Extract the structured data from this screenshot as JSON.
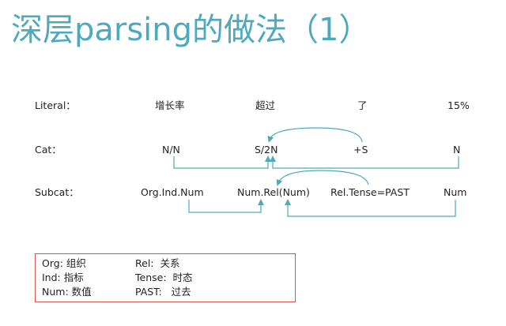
{
  "title": "深层parsing的做法（1）",
  "rows": {
    "literal": {
      "label": "Literal：",
      "tokens": [
        "增长率",
        "超过",
        "了",
        "15%"
      ]
    },
    "cat": {
      "label": "Cat：",
      "tokens": [
        "N/N",
        "S/2N",
        "+S",
        "N"
      ]
    },
    "subcat": {
      "label": "Subcat：",
      "tokens": [
        "Org.Ind.Num",
        "Num.Rel(Num)",
        "Rel.Tense=PAST",
        "Num"
      ]
    }
  },
  "legend": {
    "left": [
      {
        "key": "Org:",
        "value": "组织"
      },
      {
        "key": "Ind:",
        "value": "指标"
      },
      {
        "key": "Num:",
        "value": "数值"
      }
    ],
    "right": [
      {
        "key": "Rel:",
        "value": "关系"
      },
      {
        "key": "Tense:",
        "value": "时态"
      },
      {
        "key": "PAST:",
        "value": "过去"
      }
    ]
  },
  "colors": {
    "title": "#4ea9bd",
    "arrow": "#4ea9bd",
    "legend_border": "#d9534f"
  }
}
